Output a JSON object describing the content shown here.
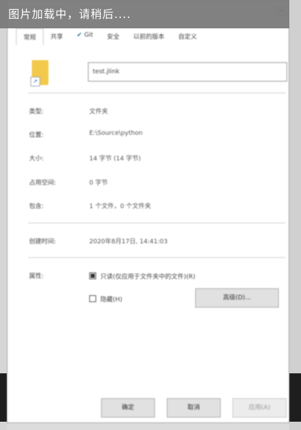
{
  "loading_message": "图片加载中，请稍后....",
  "tabs": [
    {
      "label": "常规",
      "active": true
    },
    {
      "label": "共享",
      "active": false
    },
    {
      "label": "Git",
      "active": false,
      "icon": "git-check-icon"
    },
    {
      "label": "安全",
      "active": false
    },
    {
      "label": "以前的版本",
      "active": false
    },
    {
      "label": "自定义",
      "active": false
    }
  ],
  "name_field": {
    "value": "test.jlink"
  },
  "properties": {
    "type_label": "类型:",
    "type_value": "文件夹",
    "location_label": "位置:",
    "location_value": "E:\\Source\\python",
    "size_label": "大小:",
    "size_value": "14 字节 (14 字节)",
    "disk_size_label": "占用空间:",
    "disk_size_value": "0 字节",
    "contains_label": "包含:",
    "contains_value": "1 个文件，0 个文件夹",
    "created_label": "创建时间:",
    "created_value": "2020年8月17日, 14:41:03",
    "attributes_label": "属性:",
    "readonly_label": "只读(仅应用于文件夹中的文件)(R)",
    "readonly_checked": true,
    "hidden_label": "隐藏(H)",
    "hidden_checked": false,
    "advanced_button": "高级(D)..."
  },
  "footer": {
    "ok": "确定",
    "cancel": "取消",
    "apply": "应用(A)"
  },
  "colors": {
    "folder": "#f3c94b",
    "loading_overlay": "#767676",
    "dialog_bg": "#ffffff"
  }
}
